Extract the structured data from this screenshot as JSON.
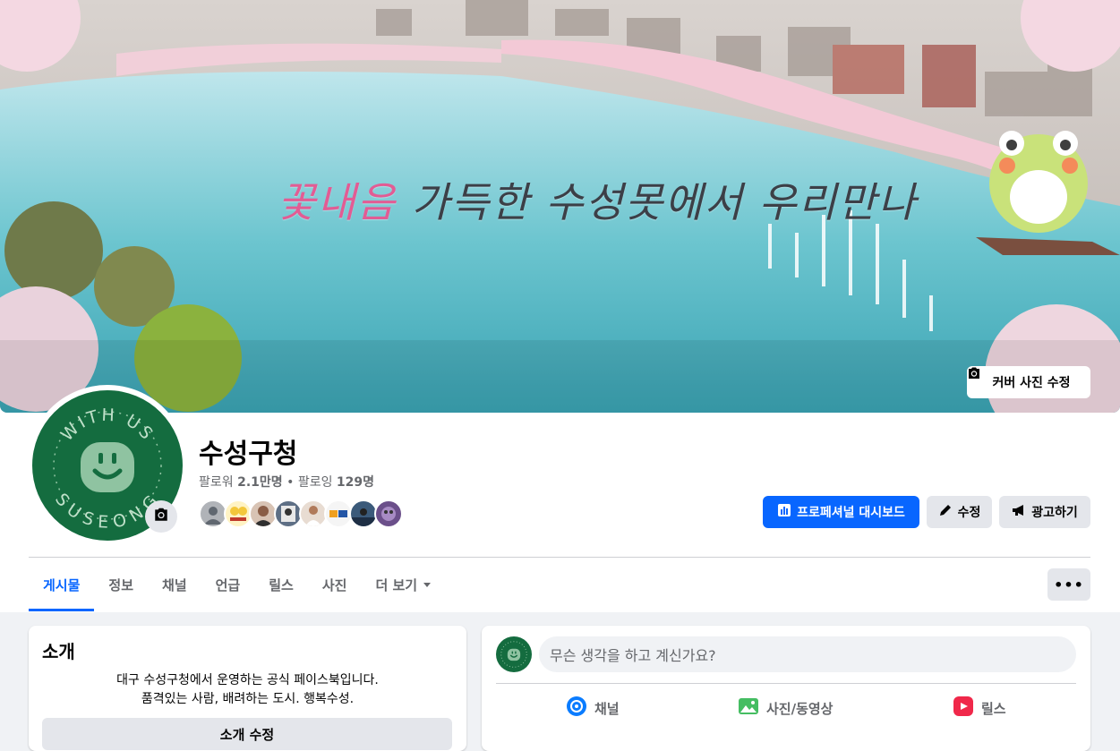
{
  "cover": {
    "headline_pink": "꽃내음",
    "headline_rest": "가득한 수성못에서 우리만나",
    "edit_cover_label": "커버 사진 수정"
  },
  "profile": {
    "name": "수성구청",
    "followers_label": "팔로워",
    "followers_count": "2.1만명",
    "separator": "•",
    "following_label": "팔로잉",
    "following_count": "129명",
    "logo_text_top": "WITH US",
    "logo_text_bottom": "SUSEONG"
  },
  "actions": {
    "dashboard_label": "프로페셔널 대시보드",
    "edit_label": "수정",
    "advertise_label": "광고하기"
  },
  "tabs": [
    {
      "label": "게시물",
      "active": true
    },
    {
      "label": "정보"
    },
    {
      "label": "채널"
    },
    {
      "label": "언급"
    },
    {
      "label": "릴스"
    },
    {
      "label": "사진"
    },
    {
      "label": "더 보기"
    }
  ],
  "more_menu_glyph": "•••",
  "intro": {
    "title": "소개",
    "line1": "대구 수성구청에서 운영하는 공식 페이스북입니다.",
    "line2": "품격있는 사람, 배려하는 도시. 행복수성.",
    "edit_button_label": "소개 수정"
  },
  "composer": {
    "placeholder": "무슨 생각을 하고 계신가요?",
    "channel_label": "채널",
    "photo_label": "사진/동영상",
    "reels_label": "릴스"
  },
  "colors": {
    "primary": "#0866ff",
    "logo_green": "#146c3f",
    "background": "#f0f2f5"
  }
}
